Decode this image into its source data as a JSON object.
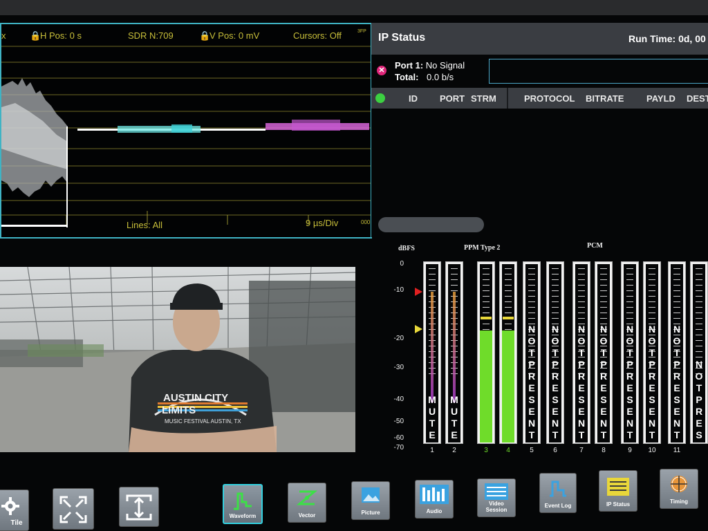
{
  "waveform": {
    "header": {
      "x_prefix": "x",
      "hpos": "H Pos: 0 s",
      "sdr": "SDR N:709",
      "vpos": "V Pos: 0 mV",
      "cursors": "Cursors: Off",
      "right_tag": "3FP"
    },
    "footer": {
      "lines": "Lines: All",
      "div": "9 µs/Div",
      "right_tag": "000"
    }
  },
  "ip_status": {
    "title": "IP Status",
    "run_time": "Run Time: 0d, 00",
    "port_label": "Port 1:",
    "port_value": "No Signal",
    "total_label": "Total:",
    "total_value": "0.0 b/s",
    "columns": [
      "ID",
      "PORT",
      "STRM",
      "PROTOCOL",
      "BITRATE",
      "PAYLD",
      "DEST"
    ]
  },
  "audio": {
    "unit": "dBFS",
    "group1": "PPM Type 2",
    "group2": "PCM",
    "scale": [
      "0",
      "-10",
      "-20",
      "-30",
      "-40",
      "-50",
      "-60",
      "-70"
    ],
    "channels": [
      {
        "num": "1",
        "state": "MUTE",
        "level_db": -70
      },
      {
        "num": "2",
        "state": "MUTE",
        "level_db": -70
      },
      {
        "num": "3",
        "state": "",
        "level_db": -26
      },
      {
        "num": "4",
        "state": "",
        "level_db": -26
      },
      {
        "num": "5",
        "state": "NOT PRESENT",
        "level_db": -70
      },
      {
        "num": "6",
        "state": "NOT PRESENT",
        "level_db": -70
      },
      {
        "num": "7",
        "state": "NOT PRESENT",
        "level_db": -70
      },
      {
        "num": "8",
        "state": "NOT PRESENT",
        "level_db": -70
      },
      {
        "num": "9",
        "state": "NOT PRESENT",
        "level_db": -70
      },
      {
        "num": "10",
        "state": "NOT PRESENT",
        "level_db": -70
      },
      {
        "num": "11",
        "state": "NOT PRESENT",
        "level_db": -70
      },
      {
        "num": "",
        "state": "NOT PRES",
        "level_db": -70
      }
    ],
    "marker_red_db": -10,
    "marker_yellow_db": -18
  },
  "picture": {
    "shirt_line1": "AUSTIN CITY",
    "shirt_line2": "LIMITS",
    "shirt_line3": "MUSIC FESTIVAL  AUSTIN, TX"
  },
  "toolbar": {
    "tile": "Tile",
    "waveform": "Waveform",
    "vector": "Vector",
    "picture": "Picture",
    "audio": "Audio",
    "video_session_1": "Video",
    "video_session_2": "Session",
    "event_log": "Event Log",
    "ip_status": "IP Status",
    "timing": "Timing"
  },
  "colors": {
    "accent_cyan": "#32d1e0",
    "label_yellow": "#c8bf3a",
    "meter_green": "#6fdc2a",
    "status_red": "#e0267a"
  }
}
